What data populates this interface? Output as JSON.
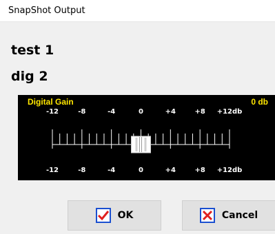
{
  "window": {
    "title": "SnapShot Output"
  },
  "labels": {
    "line1": "test 1",
    "line2": "dig 2"
  },
  "gain": {
    "title": "Digital Gain",
    "value": "0 db",
    "scale_labels": [
      "-12",
      "-8",
      "-4",
      "0",
      "+4",
      "+8",
      "+12db"
    ],
    "min_db": -12,
    "max_db": 12,
    "current_db": 0
  },
  "buttons": {
    "ok": "OK",
    "cancel": "Cancel"
  },
  "colors": {
    "accent": "#ffe600",
    "panel": "#000000",
    "check": "#e02020",
    "x": "#e02020",
    "border_blue": "#1a4fd0"
  },
  "icons": {
    "ok": "check-icon",
    "cancel": "x-icon"
  }
}
